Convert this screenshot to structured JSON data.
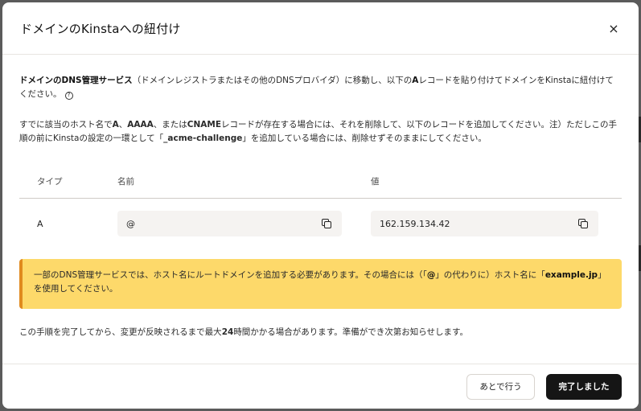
{
  "dialog": {
    "title": "ドメインのKinstaへの紐付け",
    "close_glyph": "×"
  },
  "intro": {
    "bold_lead": "ドメインのDNS管理サービス",
    "text": "（ドメインレジストラまたはその他のDNSプロバイダ）に移動し、以下の",
    "bold_a": "A",
    "text2": "レコードを貼り付けてドメインを",
    "bold_kinsta": "Kinsta",
    "text3": "に紐付けてください。",
    "help_glyph": "?"
  },
  "note": {
    "text": "すでに該当のホスト名で",
    "bold1": "A",
    "sep1": "、",
    "bold2": "AAAA",
    "sep2": "、または",
    "bold3": "CNAME",
    "text2": "レコードが存在する場合には、それを削除して、以下のレコードを追加してください。注）ただしこの手順の前にKinstaの設定の一環として「",
    "bold4": "_acme-challenge",
    "text3": "」を追加している場合には、削除せずそのままにしてください。"
  },
  "table": {
    "headers": {
      "type": "タイプ",
      "name": "名前",
      "value": "値"
    },
    "row": {
      "type": "A",
      "name": "@",
      "value": "162.159.134.42"
    }
  },
  "warning": {
    "text": "一部のDNS管理サービスでは、ホスト名にルートドメインを追加する必要があります。その場合には（「",
    "bold1": "@",
    "text2": "」の代わりに）ホスト名に「",
    "bold2": "example.jp",
    "text3": "」を使用してください。"
  },
  "footer_note": {
    "text": "この手順を完了してから、変更が反映されるまで最大",
    "bold": "24",
    "text2": "時間かかる場合があります。準備ができ次第お知らせします。"
  },
  "buttons": {
    "later": "あとで行う",
    "done": "完了しました"
  },
  "colors": {
    "warning_bg": "#fdd96a",
    "warning_border": "#e08a1e",
    "primary_button": "#151515"
  }
}
